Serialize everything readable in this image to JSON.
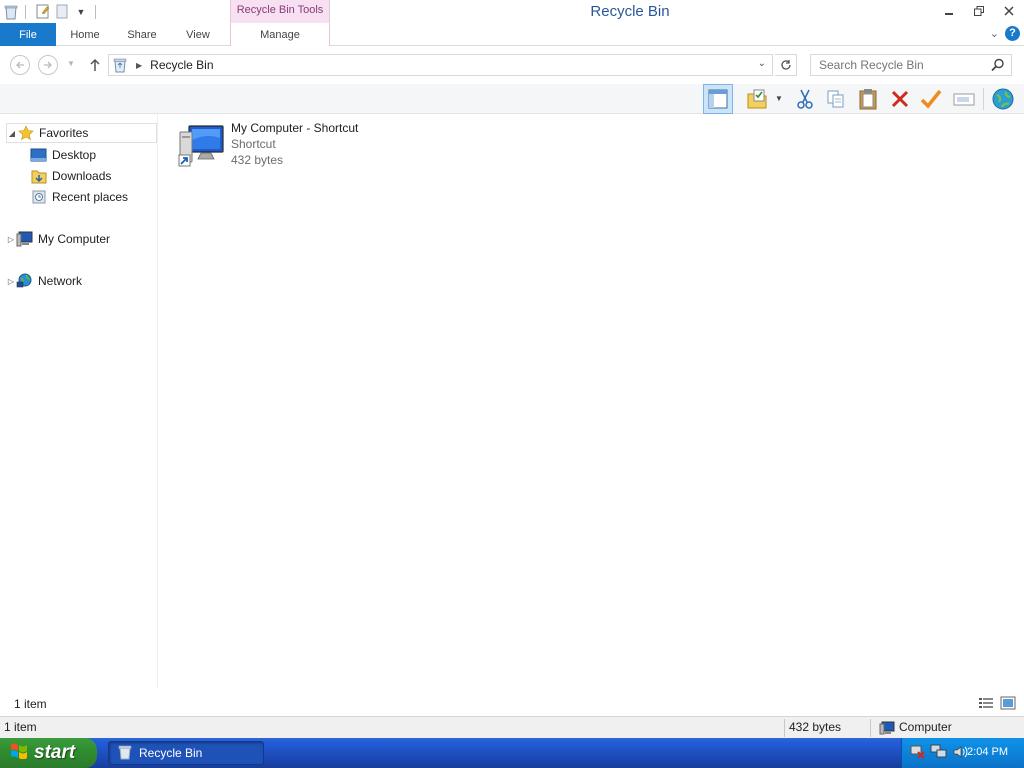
{
  "window": {
    "title": "Recycle Bin",
    "context_tab_group": "Recycle Bin Tools"
  },
  "ribbon": {
    "tabs": [
      {
        "label": "File"
      },
      {
        "label": "Home"
      },
      {
        "label": "Share"
      },
      {
        "label": "View"
      },
      {
        "label": "Manage"
      }
    ]
  },
  "address": {
    "path": "Recycle Bin",
    "search_placeholder": "Search Recycle Bin"
  },
  "navigation": {
    "favorites": {
      "label": "Favorites",
      "items": [
        {
          "label": "Desktop"
        },
        {
          "label": "Downloads"
        },
        {
          "label": "Recent places"
        }
      ]
    },
    "computer": {
      "label": "My Computer"
    },
    "network": {
      "label": "Network"
    }
  },
  "content": {
    "items": [
      {
        "name": "My Computer - Shortcut",
        "type": "Shortcut",
        "size": "432 bytes"
      }
    ]
  },
  "status": {
    "item_count": "1 item"
  },
  "details_bar": {
    "count": "1 item",
    "size": "432 bytes",
    "location": "Computer"
  },
  "taskbar": {
    "start_label": "start",
    "window_button": "Recycle Bin",
    "clock": "2:04 PM"
  },
  "colors": {
    "file_tab": "#1979ca",
    "context_tab": "#f7e0f1",
    "taskbar": "#245edb",
    "start_button": "#2f8f2f",
    "tray": "#0d8ae0"
  }
}
